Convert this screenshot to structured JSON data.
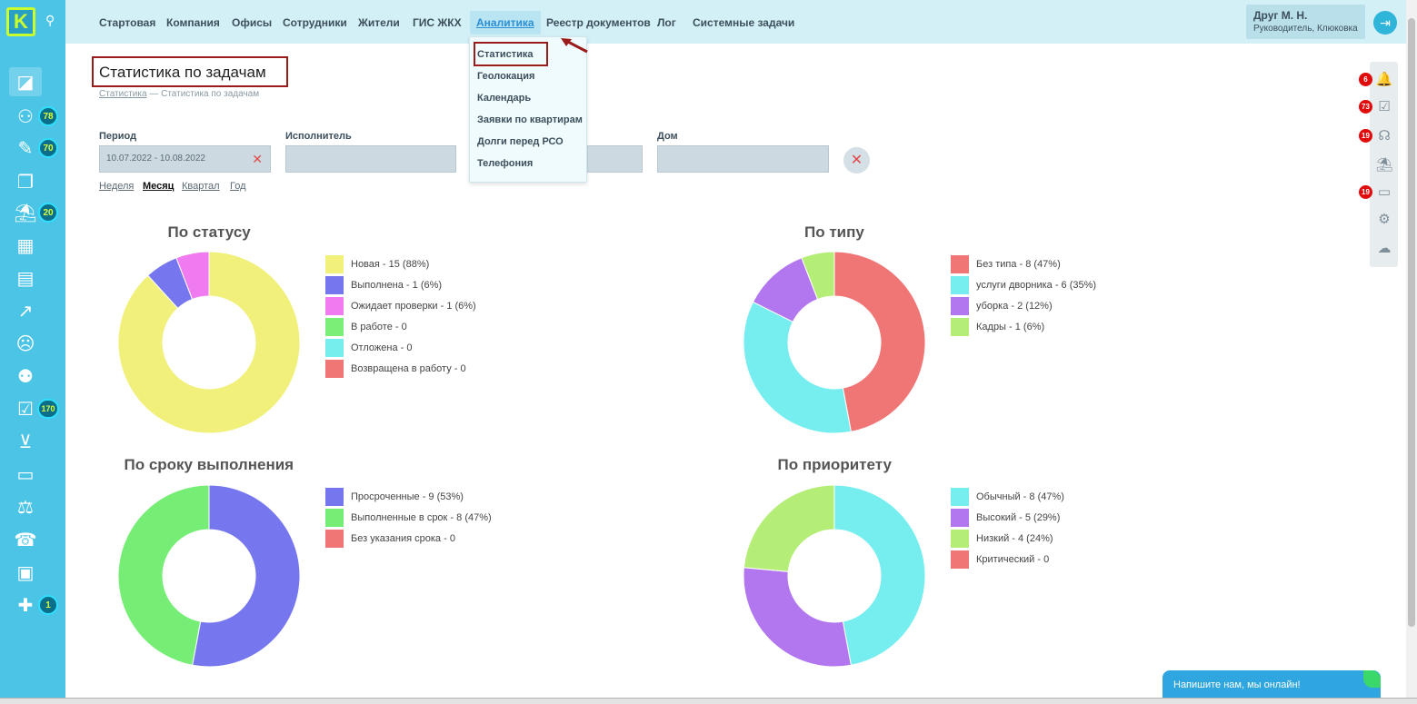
{
  "app": {
    "logo_letter": "K"
  },
  "sidebar": {
    "items": [
      {
        "icon": "logo-flag-icon",
        "glyph": "◪",
        "badge": ""
      },
      {
        "icon": "residents-icon",
        "glyph": "⚇",
        "badge": "78"
      },
      {
        "icon": "edit-doc-icon",
        "glyph": "✎",
        "badge": "70"
      },
      {
        "icon": "documents-icon",
        "glyph": "❐",
        "badge": ""
      },
      {
        "icon": "desk-icon",
        "glyph": "⛱",
        "badge": "20"
      },
      {
        "icon": "building-icon",
        "glyph": "▦",
        "badge": ""
      },
      {
        "icon": "calculator-icon",
        "glyph": "▤",
        "badge": ""
      },
      {
        "icon": "analytics-icon",
        "glyph": "↗",
        "badge": ""
      },
      {
        "icon": "sad-face-icon",
        "glyph": "☹",
        "badge": ""
      },
      {
        "icon": "team-icon",
        "glyph": "⚉",
        "badge": ""
      },
      {
        "icon": "tasks-icon",
        "glyph": "☑",
        "badge": "170"
      },
      {
        "icon": "cart-icon",
        "glyph": "⊻",
        "badge": ""
      },
      {
        "icon": "wallet-icon",
        "glyph": "▭",
        "badge": ""
      },
      {
        "icon": "scales-icon",
        "glyph": "⚖",
        "badge": ""
      },
      {
        "icon": "phone-icon",
        "glyph": "☎",
        "badge": ""
      },
      {
        "icon": "board-icon",
        "glyph": "▣",
        "badge": ""
      },
      {
        "icon": "chat-plus-icon",
        "glyph": "✚",
        "badge": "1"
      }
    ]
  },
  "nav": {
    "items": [
      {
        "label": "Стартовая"
      },
      {
        "label": "Компания"
      },
      {
        "label": "Офисы"
      },
      {
        "label": "Сотрудники"
      },
      {
        "label": "Жители"
      },
      {
        "label": "ГИС ЖКХ"
      },
      {
        "label": "Аналитика",
        "active": true
      },
      {
        "label": "Реестр документов"
      },
      {
        "label": "Лог"
      },
      {
        "label": "Системные задачи"
      }
    ]
  },
  "user": {
    "name": "Друг М. Н.",
    "role": "Руководитель, Клюковка"
  },
  "dropdown": {
    "items": [
      {
        "label": "Статистика"
      },
      {
        "label": "Геолокация"
      },
      {
        "label": "Календарь"
      },
      {
        "label": "Заявки по квартирам"
      },
      {
        "label": "Долги перед РСО"
      },
      {
        "label": "Телефония"
      }
    ]
  },
  "page": {
    "title": "Статистика по задачам",
    "breadcrumb_link": "Статистика",
    "breadcrumb_sep": " — ",
    "breadcrumb_current": "Статистика по задачам"
  },
  "filters": {
    "period_label": "Период",
    "period_value": "10.07.2022 - 10.08.2022",
    "executor_label": "Исполнитель",
    "executor_value": "",
    "house_label": "Дом",
    "house_value": "",
    "clear_glyph": "✕",
    "periods": [
      {
        "label": "Неделя"
      },
      {
        "label": "Месяц",
        "active": true
      },
      {
        "label": "Квартал"
      },
      {
        "label": "Год"
      }
    ]
  },
  "chart_data": [
    {
      "type": "pie",
      "title": "По статусу",
      "categories": [
        "Новая",
        "Выполнена",
        "Ожидает проверки",
        "В работе",
        "Отложена",
        "Возвращена в работу"
      ],
      "values": [
        15,
        1,
        1,
        0,
        0,
        0
      ],
      "legend": [
        "Новая - 15 (88%)",
        "Выполнена - 1 (6%)",
        "Ожидает проверки - 1 (6%)",
        "В работе - 0",
        "Отложена - 0",
        "Возвращена в работу - 0"
      ],
      "colors": [
        "#f0f07a",
        "#7676ee",
        "#f07af0",
        "#7aee76",
        "#76eeee",
        "#f07676"
      ],
      "legend_position": "right"
    },
    {
      "type": "pie",
      "title": "По типу",
      "categories": [
        "Без типа",
        "услуги дворника",
        "уборка",
        "Кадры"
      ],
      "values": [
        8,
        6,
        2,
        1
      ],
      "legend": [
        "Без типа - 8 (47%)",
        "услуги дворника - 6 (35%)",
        "уборка - 2 (12%)",
        "Кадры - 1 (6%)"
      ],
      "colors": [
        "#f07676",
        "#76eef0",
        "#b276ee",
        "#b4ee76"
      ],
      "legend_position": "right"
    },
    {
      "type": "pie",
      "title": "По сроку выполнения",
      "categories": [
        "Просроченные",
        "Выполненные в срок",
        "Без указания срока"
      ],
      "values": [
        9,
        8,
        0
      ],
      "legend": [
        "Просроченные - 9 (53%)",
        "Выполненные в срок - 8 (47%)",
        "Без указания срока - 0"
      ],
      "colors": [
        "#7676ee",
        "#76ee76",
        "#f07676"
      ],
      "legend_position": "right"
    },
    {
      "type": "pie",
      "title": "По приоритету",
      "categories": [
        "Обычный",
        "Высокий",
        "Низкий",
        "Критический"
      ],
      "values": [
        8,
        5,
        4,
        0
      ],
      "legend": [
        "Обычный - 8 (47%)",
        "Высокий - 5 (29%)",
        "Низкий - 4 (24%)",
        "Критический - 0"
      ],
      "colors": [
        "#76eef0",
        "#b276ee",
        "#b4ee76",
        "#f07676"
      ],
      "legend_position": "right"
    }
  ],
  "rail": {
    "items": [
      {
        "icon": "bell-icon",
        "glyph": "🔔",
        "badge": "6"
      },
      {
        "icon": "clipboard-icon",
        "glyph": "☑",
        "badge": "73"
      },
      {
        "icon": "headset-icon",
        "glyph": "☊",
        "badge": "19"
      },
      {
        "icon": "desk-icon",
        "glyph": "⛱",
        "badge": ""
      },
      {
        "icon": "message-icon",
        "glyph": "▭",
        "badge": "19"
      },
      {
        "icon": "settings-icon",
        "glyph": "⚙",
        "badge": ""
      },
      {
        "icon": "chat-icon",
        "glyph": "☁",
        "badge": ""
      }
    ]
  },
  "chat": {
    "label": "Напишите нам, мы онлайн!"
  }
}
